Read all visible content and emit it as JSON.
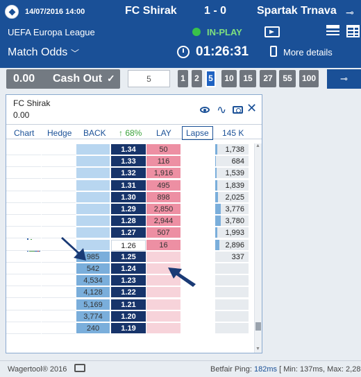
{
  "header": {
    "date_time": "14/07/2016 14:00",
    "home_team": "FC Shirak",
    "score": "1 - 0",
    "away_team": "Spartak Trnava",
    "competition": "UEFA Europa League",
    "status": "IN-PLAY",
    "market": "Match Odds",
    "timer": "01:26:31",
    "more_details": "More details",
    "pin_glyph": "⊸"
  },
  "toolbar": {
    "cashout_value": "0.00",
    "cashout_label": "Cash Out",
    "cashout_check": "✓",
    "stake_value": "5",
    "stakes": [
      "1",
      "2",
      "5",
      "10",
      "15",
      "27",
      "55",
      "100"
    ],
    "active_stake": "5"
  },
  "ladder": {
    "runner": "FC Shirak",
    "pl": "0.00",
    "tabs": {
      "chart": "Chart",
      "hedge": "Hedge",
      "back": "BACK",
      "pct": "↑ 68%",
      "lay": "LAY",
      "lapse": "Lapse",
      "total": "145 K"
    },
    "rows": [
      {
        "back": "",
        "price": "1.34",
        "lay": "50",
        "tv": "1,738",
        "tvw": 0.06
      },
      {
        "back": "",
        "price": "1.33",
        "lay": "116",
        "tv": "684",
        "tvw": 0.02
      },
      {
        "back": "",
        "price": "1.32",
        "lay": "1,916",
        "tv": "1,539",
        "tvw": 0.05
      },
      {
        "back": "",
        "price": "1.31",
        "lay": "495",
        "tv": "1,839",
        "tvw": 0.06
      },
      {
        "back": "",
        "price": "1.30",
        "lay": "898",
        "tv": "2,025",
        "tvw": 0.08
      },
      {
        "back": "",
        "price": "1.29",
        "lay": "2,850",
        "tv": "3,776",
        "tvw": 0.16
      },
      {
        "back": "",
        "price": "1.28",
        "lay": "2,944",
        "tv": "3,780",
        "tvw": 0.16
      },
      {
        "back": "",
        "price": "1.27",
        "lay": "507",
        "tv": "1,993",
        "tvw": 0.07
      },
      {
        "back": "",
        "price": "1.26",
        "lay": "16",
        "tv": "2,896",
        "tvw": 0.12
      },
      {
        "back": "985",
        "price": "1.25",
        "lay": "",
        "tv": "337",
        "tvw": 0
      },
      {
        "back": "542",
        "price": "1.24",
        "lay": "",
        "tv": "",
        "tvw": 0
      },
      {
        "back": "4,534",
        "price": "1.23",
        "lay": "",
        "tv": "",
        "tvw": 0
      },
      {
        "back": "4,128",
        "price": "1.22",
        "lay": "",
        "tv": "",
        "tvw": 0
      },
      {
        "back": "5,169",
        "price": "1.21",
        "lay": "",
        "tv": "",
        "tvw": 0
      },
      {
        "back": "3,774",
        "price": "1.20",
        "lay": "",
        "tv": "",
        "tvw": 0
      },
      {
        "back": "240",
        "price": "1.19",
        "lay": "",
        "tv": "",
        "tvw": 0
      }
    ]
  },
  "footer": {
    "brand": "Wagertool® 2016",
    "ping_label": "Betfair Ping:",
    "ping_value": "182ms",
    "ping_range": "[ Min: 137ms, Max: 2,28"
  },
  "colors": {
    "header": "#1a5097",
    "back": "#b8d6f0",
    "lay": "#f4b8c4",
    "price": "#17346a",
    "inplay": "#39c24a"
  }
}
